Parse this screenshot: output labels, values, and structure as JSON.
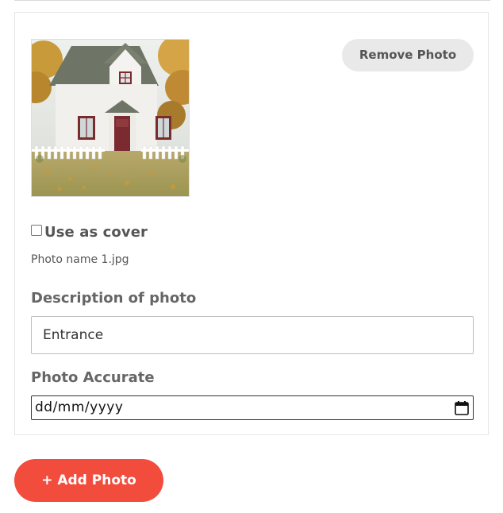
{
  "photo_card": {
    "thumbnail_alt": "House photo",
    "remove_label": "Remove Photo",
    "cover_checkbox": {
      "label": "Use as cover",
      "checked": false
    },
    "file_name": "Photo name 1.jpg",
    "description": {
      "label": "Description of photo",
      "value": "Entrance"
    },
    "date": {
      "label": "Photo Accurate",
      "placeholder": "dd/mm/yyyy",
      "icon": "calendar-icon"
    }
  },
  "add_photo_label": "+ Add Photo",
  "colors": {
    "accent": "#f24c3d",
    "secondary_button": "#e9e9e9",
    "label_text": "#666666"
  }
}
